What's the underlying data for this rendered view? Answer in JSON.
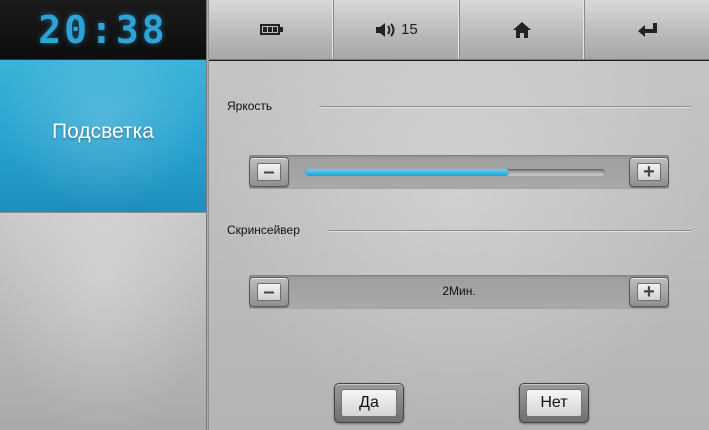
{
  "clock": {
    "time": "20:38"
  },
  "sidebar": {
    "items": [
      {
        "label": "Подсветка",
        "active": true
      }
    ]
  },
  "toolbar": {
    "battery": {
      "icon": "battery-icon"
    },
    "volume": {
      "icon": "volume-icon",
      "level": "15"
    },
    "home": {
      "icon": "home-icon"
    },
    "back": {
      "icon": "back-arrow-icon"
    }
  },
  "brightness": {
    "label": "Яркость",
    "level_fraction": 0.68,
    "minus_symbol": "–",
    "plus_symbol": "+"
  },
  "screensaver": {
    "label": "Скринсейвер",
    "value": "2Мин.",
    "minus_symbol": "–",
    "plus_symbol": "+"
  },
  "actions": {
    "ok_label": "Да",
    "cancel_label": "Нет"
  },
  "colors": {
    "accent": "#27a2cf",
    "clock": "#2da4d8",
    "slider_fill": "#1f9fd4"
  }
}
